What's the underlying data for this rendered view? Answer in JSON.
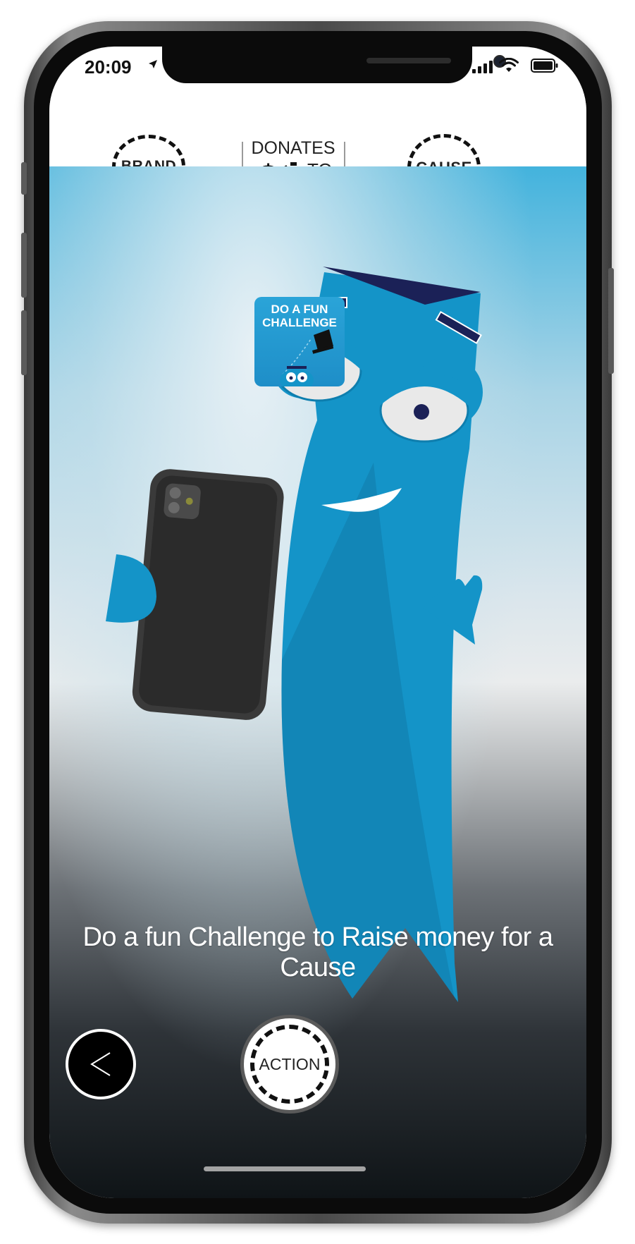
{
  "status_bar": {
    "time": "20:09"
  },
  "header": {
    "brand_label": "BRAND",
    "donates_label": "DONATES",
    "currency_symbol": "$",
    "to_label": "TO",
    "cause_label": "CAUSE"
  },
  "challenge_card": {
    "title_line1": "DO A FUN",
    "title_line2": "CHALLENGE"
  },
  "scene": {
    "caption": "Do a fun Challenge to Raise money for a Cause"
  },
  "controls": {
    "action_label": "ACTION"
  },
  "icons": {
    "back": "chevron-left-icon",
    "location": "location-arrow-icon",
    "signal": "signal-icon",
    "wifi": "wifi-icon",
    "battery": "battery-icon"
  },
  "colors": {
    "accent_blue": "#0e8cc4",
    "character_blue": "#1494c8",
    "hat_navy": "#1b2157",
    "header_bg": "#ffffff",
    "badge_ink": "#111111"
  }
}
